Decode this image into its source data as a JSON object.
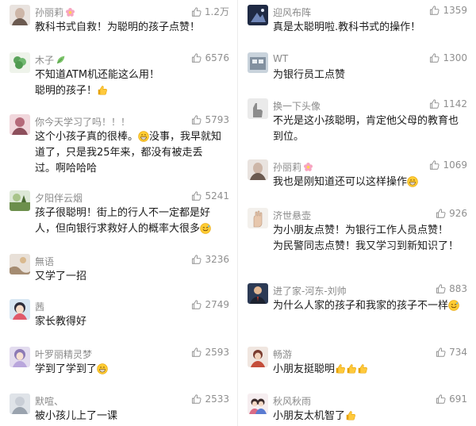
{
  "comments_left": [
    {
      "user": "孙丽莉",
      "likes": "1.2万",
      "text": "教科书式自救！为聪明的孩子点赞！"
    },
    {
      "user": "木子",
      "likes": "6576",
      "text": "不知道ATM机还能这么用！\n聪明的孩子！"
    },
    {
      "user": "你今天学习了吗！！！",
      "likes": "5793",
      "text_a": "这个小孩子真的很棒。",
      "text_b": "没事，我早就知道了，只是我25年来，都没有被走丢过。啊哈哈哈"
    },
    {
      "user": "夕阳伴云烟",
      "likes": "5241",
      "text": "孩子很聪明！街上的行人不一定都是好人，但向银行求救好人的概率大很多"
    },
    {
      "user": "無语",
      "likes": "3236",
      "text": "又学了一招"
    },
    {
      "user": "茜",
      "likes": "2749",
      "text": "家长教得好"
    },
    {
      "user": "叶罗丽精灵梦",
      "likes": "2593",
      "text": "学到了学到了"
    },
    {
      "user": "默喧、",
      "likes": "2533",
      "text": "被小孩儿上了一课"
    }
  ],
  "comments_right": [
    {
      "user": "迎风布阵",
      "likes": "1359",
      "text": "真是太聪明啦.教科书式的操作！"
    },
    {
      "user": "WT",
      "likes": "1300",
      "text": "为银行员工点赞"
    },
    {
      "user": "换一下头像",
      "likes": "1142",
      "text": "不光是这小孩聪明，肯定他父母的教育也到位。"
    },
    {
      "user": "孙丽莉",
      "likes": "1069",
      "text": "我也是刚知道还可以这样操作"
    },
    {
      "user": "济世悬壶",
      "likes": "926",
      "text": "为小朋友点赞！为银行工作人员点赞！\n为民警同志点赞！我又学习到新知识了！"
    },
    {
      "user": "进了家-河东-刘帅",
      "likes": "883",
      "text": "为什么人家的孩子和我家的孩子不一样"
    },
    {
      "user": "畅游",
      "likes": "734",
      "text": "小朋友挺聪明"
    },
    {
      "user": "秋风秋雨",
      "likes": "691",
      "text": "小朋友太机智了"
    }
  ],
  "icons": {
    "like": "thumbs-up-outline-icon",
    "thumbs_emoji": "thumbs-up-emoji-icon",
    "grin_emoji": "grin-emoji-icon",
    "sweat_emoji": "sweat-smile-emoji-icon",
    "flower_badge": "flower-badge-icon",
    "leaf_badge": "leaf-badge-icon"
  },
  "colors": {
    "username": "#8a8a8a",
    "text": "#1a1a1a",
    "like": "#8f8f8f",
    "emoji": "#f4b400"
  }
}
